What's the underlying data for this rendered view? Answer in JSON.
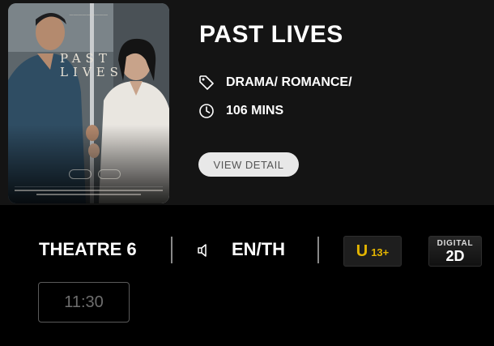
{
  "movie": {
    "title": "PAST LIVES",
    "genre": "DRAMA/ ROMANCE/",
    "duration": "106 MINS",
    "view_detail_label": "VIEW DETAIL",
    "poster": {
      "title_line1": "PAST",
      "title_line2": "LIVES",
      "colors": {
        "background": "#4a5257",
        "text": "#e8e2d6"
      }
    }
  },
  "session": {
    "theatre": "THEATRE 6",
    "language": "EN/TH",
    "rating": {
      "letter": "U",
      "age": "13+",
      "color": "#e3b400"
    },
    "format": {
      "top": "DIGITAL",
      "bottom": "2D"
    },
    "showtimes": [
      "11:30"
    ]
  },
  "icons": {
    "genre": "tag-icon",
    "duration": "clock-icon",
    "language": "speaker-icon"
  }
}
